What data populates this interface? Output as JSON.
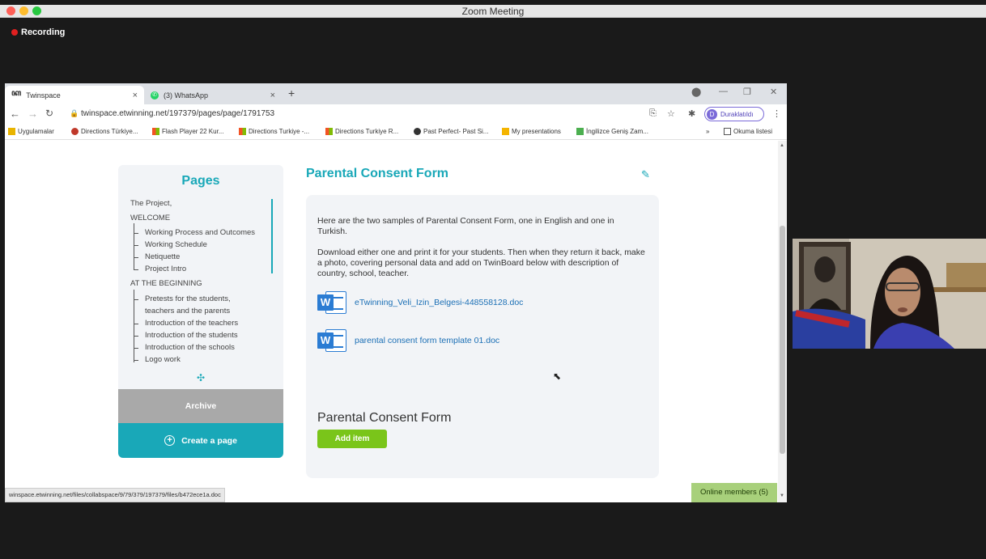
{
  "zoom": {
    "title": "Zoom Meeting",
    "recording": "Recording"
  },
  "browser": {
    "tabs": [
      {
        "label": "Twinspace",
        "close": "×"
      },
      {
        "label": "(3) WhatsApp",
        "close": "×"
      }
    ],
    "new_tab": "+",
    "url": "twinspace.etwinning.net/197379/pages/page/1791753",
    "profile": {
      "initial": "D",
      "label": "Duraklatıldı"
    },
    "bookmarks": [
      "Uygulamalar",
      "Directions Türkiye...",
      "Flash Player 22 Kur...",
      "Directions Turkiye -...",
      "Directions Turkiye R...",
      "Past Perfect- Past Si...",
      "My presentations",
      "İngilizce Geniş Zam..."
    ],
    "reading_list": "Okuma listesi",
    "status_url": "winspace.etwinning.net/files/collabspace/9/79/379/197379/files/b472ece1a.doc"
  },
  "sidebar": {
    "title": "Pages",
    "items": [
      {
        "label": "The Project,",
        "level": 0
      },
      {
        "label": "WELCOME",
        "level": 0
      },
      {
        "label": "Working Process and Outcomes",
        "level": 1
      },
      {
        "label": "Working Schedule",
        "level": 1
      },
      {
        "label": "Netiquette",
        "level": 1
      },
      {
        "label": "Project Intro",
        "level": 1
      },
      {
        "label": "AT THE BEGINNING",
        "level": 0
      },
      {
        "label": "Pretests for the students,",
        "level": 1
      },
      {
        "label": "teachers and the parents",
        "level": 1
      },
      {
        "label": "Introduction of the teachers",
        "level": 1
      },
      {
        "label": "Introduction of the students",
        "level": 1
      },
      {
        "label": "Introduction of the schools",
        "level": 1
      },
      {
        "label": "Logo work",
        "level": 1
      }
    ],
    "archive": "Archive",
    "create": "Create a page"
  },
  "main": {
    "title": "Parental Consent Form",
    "intro": "Here are the two samples of Parental Consent Form, one in English and one in Turkish.",
    "instructions": "Download either one and print it for your students. Then when they return it back, make a photo, covering personal data and add on TwinBoard below with description of country, school, teacher.",
    "files": [
      "eTwinning_Veli_Izin_Belgesi-448558128.doc",
      "parental consent form template 01.doc"
    ],
    "section_title": "Parental Consent Form",
    "add_item": "Add item"
  },
  "online_members": "Online members (5)",
  "colors": {
    "accent": "#19a8b8",
    "add_button": "#7ac51a",
    "link": "#1b6fb5"
  }
}
